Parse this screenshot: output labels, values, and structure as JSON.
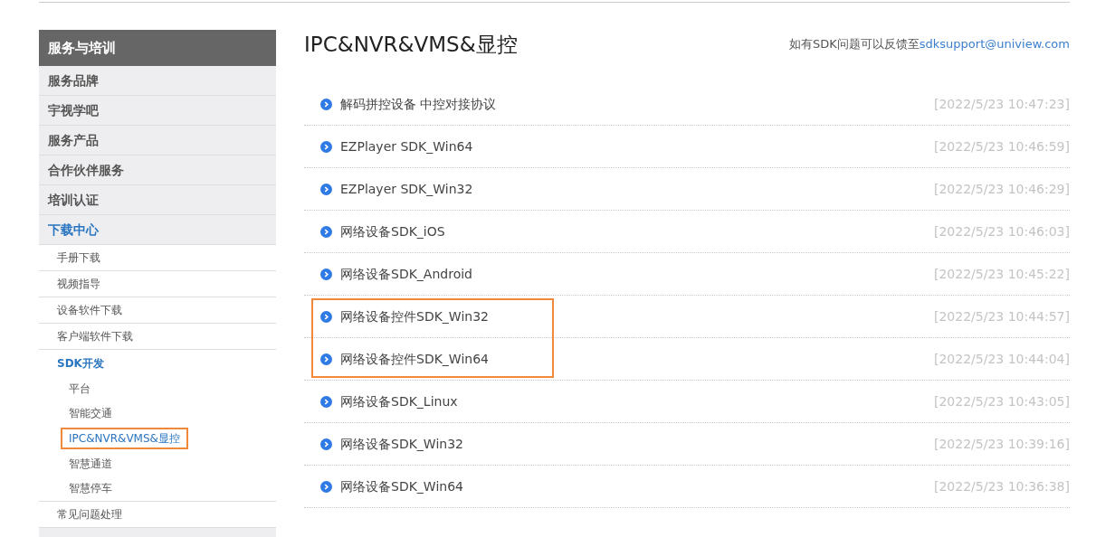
{
  "sidebar": {
    "title": "服务与培训",
    "items": [
      {
        "label": "服务品牌",
        "selected": false
      },
      {
        "label": "宇视学吧",
        "selected": false
      },
      {
        "label": "服务产品",
        "selected": false
      },
      {
        "label": "合作伙伴服务",
        "selected": false
      },
      {
        "label": "培训认证",
        "selected": false
      },
      {
        "label": "下载中心",
        "selected": true,
        "children": [
          {
            "label": "手册下载",
            "selected": false
          },
          {
            "label": "视频指导",
            "selected": false
          },
          {
            "label": "设备软件下载",
            "selected": false
          },
          {
            "label": "客户端软件下载",
            "selected": false
          },
          {
            "label": "SDK开发",
            "selected": true,
            "children": [
              {
                "label": "平台",
                "selected": false,
                "highlighted": false
              },
              {
                "label": "智能交通",
                "selected": false,
                "highlighted": false
              },
              {
                "label": "IPC&NVR&VMS&显控",
                "selected": true,
                "highlighted": true
              },
              {
                "label": "智慧通道",
                "selected": false,
                "highlighted": false
              },
              {
                "label": "智慧停车",
                "selected": false,
                "highlighted": false
              }
            ]
          },
          {
            "label": "常见问题处理",
            "selected": false
          }
        ]
      }
    ]
  },
  "main": {
    "title": "IPC&NVR&VMS&显控",
    "note": "如有SDK问题可以反馈至",
    "email": "sdksupport@uniview.com",
    "rows": [
      {
        "name": "解码拼控设备 中控对接协议",
        "time": "[2022/5/23 10:47:23]",
        "highlighted": false
      },
      {
        "name": "EZPlayer SDK_Win64",
        "time": "[2022/5/23 10:46:59]",
        "highlighted": false
      },
      {
        "name": "EZPlayer SDK_Win32",
        "time": "[2022/5/23 10:46:29]",
        "highlighted": false
      },
      {
        "name": "网络设备SDK_iOS",
        "time": "[2022/5/23 10:46:03]",
        "highlighted": false
      },
      {
        "name": "网络设备SDK_Android",
        "time": "[2022/5/23 10:45:22]",
        "highlighted": false
      },
      {
        "name": "网络设备控件SDK_Win32",
        "time": "[2022/5/23 10:44:57]",
        "highlighted": true
      },
      {
        "name": "网络设备控件SDK_Win64",
        "time": "[2022/5/23 10:44:04]",
        "highlighted": true
      },
      {
        "name": "网络设备SDK_Linux",
        "time": "[2022/5/23 10:43:05]",
        "highlighted": false
      },
      {
        "name": "网络设备SDK_Win32",
        "time": "[2022/5/23 10:39:16]",
        "highlighted": false
      },
      {
        "name": "网络设备SDK_Win64",
        "time": "[2022/5/23 10:36:38]",
        "highlighted": false
      }
    ]
  }
}
